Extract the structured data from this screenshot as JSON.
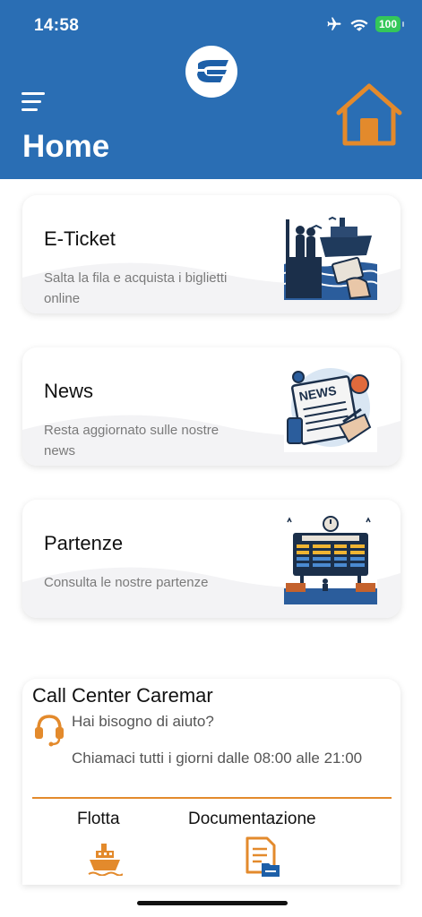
{
  "status_bar": {
    "time": "14:58",
    "battery": "100"
  },
  "header": {
    "title": "Home"
  },
  "cards": [
    {
      "title": "E-Ticket",
      "subtitle": "Salta la fila e acquista i biglietti online"
    },
    {
      "title": "News",
      "subtitle": "Resta aggiornato sulle nostre news"
    },
    {
      "title": "Partenze",
      "subtitle": "Consulta le nostre partenze"
    }
  ],
  "call_center": {
    "title": "Call Center Caremar",
    "question": "Hai bisogno di aiuto?",
    "hours": "Chiamaci tutti i giorni dalle 08:00 alle 21:00",
    "flotta_label": "Flotta",
    "doc_label": "Documentazione"
  },
  "colors": {
    "brand_blue": "#2a6eb4",
    "accent_orange": "#e38a2c",
    "battery_green": "#34c759"
  },
  "icons": [
    "airplane-icon",
    "wifi-icon",
    "battery-icon",
    "menu-icon",
    "home-icon",
    "headset-icon",
    "ship-icon",
    "document-icon"
  ]
}
